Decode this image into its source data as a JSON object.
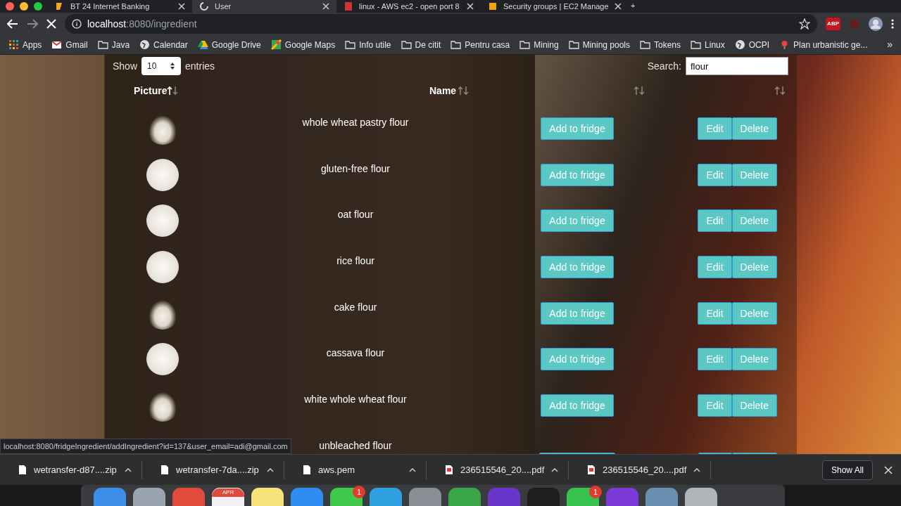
{
  "tabs": [
    {
      "title": "BT 24 Internet Banking",
      "selected": false,
      "kind": "bank"
    },
    {
      "title": "User",
      "selected": true,
      "kind": "loading"
    },
    {
      "title": "linux - AWS ec2 - open port 8",
      "selected": false,
      "kind": "doc"
    },
    {
      "title": "Security groups | EC2 Manage",
      "selected": false,
      "kind": "box"
    }
  ],
  "new_tab": "+",
  "address": {
    "host": "localhost",
    "path": ":8080/ingredient",
    "loading": true,
    "extension_badge": "ABP"
  },
  "bookmarks": [
    {
      "label": "Apps",
      "kind": "apps"
    },
    {
      "label": "Gmail",
      "kind": "mail"
    },
    {
      "label": "Java",
      "kind": "folder"
    },
    {
      "label": "Calendar",
      "kind": "globe"
    },
    {
      "label": "Google Drive",
      "kind": "drive"
    },
    {
      "label": "Google Maps",
      "kind": "map"
    },
    {
      "label": "Info utile",
      "kind": "folder"
    },
    {
      "label": "De citit",
      "kind": "folder"
    },
    {
      "label": "Pentru casa",
      "kind": "folder"
    },
    {
      "label": "Mining",
      "kind": "folder"
    },
    {
      "label": "Mining pools",
      "kind": "folder"
    },
    {
      "label": "Tokens",
      "kind": "folder"
    },
    {
      "label": "Linux",
      "kind": "folder"
    },
    {
      "label": "OCPI",
      "kind": "globe"
    },
    {
      "label": "Plan urbanistic ge...",
      "kind": "pin"
    }
  ],
  "bookmarks_more": "»",
  "table": {
    "length": {
      "before": "Show",
      "value": "10",
      "after": "entries"
    },
    "search": {
      "label": "Search:",
      "value": "flour"
    },
    "columns": [
      {
        "label": "Picture",
        "sorted": true
      },
      {
        "label": "Name",
        "sorted": false
      },
      {
        "sorted": false
      },
      {
        "sorted": false
      }
    ],
    "rows": [
      {
        "name": "whole wheat pastry flour",
        "kind": "pile",
        "actions": [
          "Add to fridge",
          "Edit",
          "Delete"
        ]
      },
      {
        "name": "gluten-free flour",
        "kind": "bowl",
        "actions": [
          "Add to fridge",
          "Edit",
          "Delete"
        ]
      },
      {
        "name": "oat flour",
        "kind": "bowl",
        "actions": [
          "Add to fridge",
          "Edit",
          "Delete"
        ]
      },
      {
        "name": "rice flour",
        "kind": "bowl",
        "actions": [
          "Add to fridge",
          "Edit",
          "Delete"
        ]
      },
      {
        "name": "cake flour",
        "kind": "pile",
        "actions": [
          "Add to fridge",
          "Edit",
          "Delete"
        ]
      },
      {
        "name": "cassava flour",
        "kind": "bowl",
        "actions": [
          "Add to fridge",
          "Edit",
          "Delete"
        ]
      },
      {
        "name": "white whole wheat flour",
        "kind": "pile",
        "actions": [
          "Add to fridge",
          "Edit",
          "Delete"
        ]
      },
      {
        "name": "unbleached flour",
        "kind": "cut"
      }
    ]
  },
  "status_url": "localhost:8080/fridgeIngredient/addIngredient?id=137&user_email=adi@gmail.com",
  "downloads": [
    {
      "name": "wetransfer-d87....zip",
      "kind": "file"
    },
    {
      "name": "wetransfer-7da....zip",
      "kind": "file"
    },
    {
      "name": "aws.pem",
      "kind": "file"
    },
    {
      "name": "236515546_20....pdf",
      "kind": "pdf"
    },
    {
      "name": "236515546_20....pdf",
      "kind": "pdf"
    }
  ],
  "show_all": "Show All",
  "dock": [
    {
      "color": "#3d8ee8"
    },
    {
      "color": "#9aa4b0"
    },
    {
      "color": "#e24a3b"
    },
    {
      "color": "#f2f2f2",
      "badge_text": "APR"
    },
    {
      "color": "#f7e27a"
    },
    {
      "color": "#2f8cf0"
    },
    {
      "color": "#3fc84a",
      "badge": "1"
    },
    {
      "color": "#2ea0e0"
    },
    {
      "color": "#8a8f96"
    },
    {
      "color": "#3ba54a"
    },
    {
      "color": "#6a35c9"
    },
    {
      "color": "#1e1e1e"
    },
    {
      "color": "#36c24d",
      "badge": "1"
    },
    {
      "color": "#7b3ad6"
    },
    {
      "color": "#6a8fb0"
    },
    {
      "color": "#b0b4b8"
    }
  ]
}
